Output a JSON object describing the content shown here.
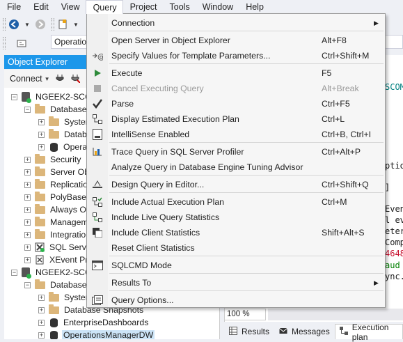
{
  "menubar": {
    "items": [
      {
        "label": "File"
      },
      {
        "label": "Edit"
      },
      {
        "label": "View"
      },
      {
        "label": "Query"
      },
      {
        "label": "Project"
      },
      {
        "label": "Tools"
      },
      {
        "label": "Window"
      },
      {
        "label": "Help"
      }
    ]
  },
  "toolbar": {
    "combo_value": "Operatio"
  },
  "object_explorer": {
    "title": "Object Explorer",
    "connect_label": "Connect",
    "tree": [
      {
        "label": "NGEEK2-SCO",
        "expander": "−",
        "icon": "server"
      },
      {
        "label": "Databases",
        "expander": "−",
        "icon": "folder"
      },
      {
        "label": "Systen",
        "expander": "+",
        "icon": "folder"
      },
      {
        "label": "Databa",
        "expander": "+",
        "icon": "folder"
      },
      {
        "label": "Operat",
        "expander": "+",
        "icon": "database"
      },
      {
        "label": "Security",
        "expander": "+",
        "icon": "folder"
      },
      {
        "label": "Server Obj",
        "expander": "+",
        "icon": "folder"
      },
      {
        "label": "Replicatio",
        "expander": "+",
        "icon": "folder"
      },
      {
        "label": "PolyBase",
        "expander": "+",
        "icon": "folder"
      },
      {
        "label": "Always Or",
        "expander": "+",
        "icon": "folder"
      },
      {
        "label": "Managem",
        "expander": "+",
        "icon": "folder"
      },
      {
        "label": "Integratio",
        "expander": "+",
        "icon": "folder"
      },
      {
        "label": "SQL Serve",
        "expander": "+",
        "icon": "agent"
      },
      {
        "label": "XEvent Pr",
        "expander": "+",
        "icon": "xevent"
      },
      {
        "label": "NGEEK2-SCO",
        "expander": "−",
        "icon": "server"
      },
      {
        "label": "Databases",
        "expander": "−",
        "icon": "folder"
      },
      {
        "label": "Systen",
        "expander": "+",
        "icon": "folder"
      },
      {
        "label": "Database Snapshots",
        "expander": "+",
        "icon": "folder"
      },
      {
        "label": "EnterpriseDashboards",
        "expander": "+",
        "icon": "database"
      },
      {
        "label": "OperationsManagerDW",
        "expander": "+",
        "icon": "database",
        "selected": true
      }
    ]
  },
  "editor": {
    "fragments": [
      {
        "text": "SCOM",
        "color": "#008080"
      },
      {
        "text": "ptio",
        "color": "#1e1e1e"
      },
      {
        "text": "]",
        "color": "#1e1e1e"
      },
      {
        "text": "Even",
        "color": "#1e1e1e"
      },
      {
        "text": "l ev",
        "color": "#1e1e1e"
      },
      {
        "text": "eter",
        "color": "#1e1e1e"
      },
      {
        "text": "Comp",
        "color": "#1e1e1e"
      },
      {
        "text": "4648",
        "color": "#c8102e"
      },
      {
        "text": " aud",
        "color": "#008000"
      },
      {
        "text": "ync.",
        "color": "#1e1e1e"
      }
    ],
    "zoom": "100 %",
    "tabs": [
      {
        "label": "Results",
        "icon": "grid-icon"
      },
      {
        "label": "Messages",
        "icon": "messages-icon"
      },
      {
        "label": "Execution plan",
        "icon": "plan-icon",
        "active": true
      }
    ]
  },
  "query_menu": {
    "items": [
      {
        "label": "Connection",
        "shortcut": "",
        "submenu": true,
        "icon": "",
        "disabled": false
      },
      {
        "label": "Open Server in Object Explorer",
        "shortcut": "Alt+F8",
        "icon": "",
        "disabled": false
      },
      {
        "label": "Specify Values for Template Parameters...",
        "shortcut": "Ctrl+Shift+M",
        "icon": "template-params-icon",
        "disabled": false
      },
      {
        "label": "Execute",
        "shortcut": "F5",
        "icon": "execute-icon",
        "disabled": false
      },
      {
        "label": "Cancel Executing Query",
        "shortcut": "Alt+Break",
        "icon": "stop-icon",
        "disabled": true
      },
      {
        "label": "Parse",
        "shortcut": "Ctrl+F5",
        "icon": "checkmark-icon",
        "disabled": false
      },
      {
        "label": "Display Estimated Execution Plan",
        "shortcut": "Ctrl+L",
        "icon": "estimated-plan-icon",
        "disabled": false
      },
      {
        "label": "IntelliSense Enabled",
        "shortcut": "Ctrl+B, Ctrl+I",
        "icon": "intellisense-icon",
        "disabled": false
      },
      {
        "label": "Trace Query in SQL Server Profiler",
        "shortcut": "Ctrl+Alt+P",
        "icon": "profiler-icon",
        "disabled": false
      },
      {
        "label": "Analyze Query in Database Engine Tuning Advisor",
        "shortcut": "",
        "icon": "",
        "disabled": false
      },
      {
        "label": "Design Query in Editor...",
        "shortcut": "Ctrl+Shift+Q",
        "icon": "design-query-icon",
        "disabled": false
      },
      {
        "label": "Include Actual Execution Plan",
        "shortcut": "Ctrl+M",
        "icon": "actual-plan-icon",
        "disabled": false
      },
      {
        "label": "Include Live Query Statistics",
        "shortcut": "",
        "icon": "live-stats-icon",
        "disabled": false
      },
      {
        "label": "Include Client Statistics",
        "shortcut": "Shift+Alt+S",
        "icon": "client-stats-icon",
        "disabled": false
      },
      {
        "label": "Reset Client Statistics",
        "shortcut": "",
        "icon": "",
        "disabled": false
      },
      {
        "label": "SQLCMD Mode",
        "shortcut": "",
        "icon": "sqlcmd-icon",
        "disabled": false
      },
      {
        "label": "Results To",
        "shortcut": "",
        "submenu": true,
        "icon": "",
        "disabled": false
      },
      {
        "label": "Query Options...",
        "shortcut": "",
        "icon": "options-icon",
        "disabled": false
      }
    ]
  }
}
